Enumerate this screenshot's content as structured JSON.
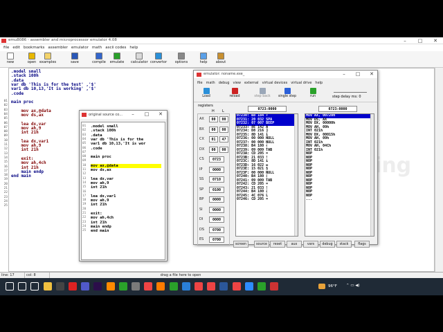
{
  "app": {
    "title": "emu8086 - assembler and microprocessor emulator 4.08",
    "menu": [
      "file",
      "edit",
      "bookmarks",
      "assembler",
      "emulator",
      "math",
      "ascii codes",
      "help"
    ],
    "toolbar": [
      {
        "label": "new",
        "icon": "new-file-icon",
        "color": "#ffffff"
      },
      {
        "label": "open",
        "icon": "open-folder-icon",
        "color": "#e8b800"
      },
      {
        "label": "examples",
        "icon": "examples-icon",
        "color": "#f3d36a"
      },
      {
        "label": "save",
        "icon": "save-icon",
        "color": "#2a58b8"
      },
      {
        "label": "compile",
        "icon": "compile-icon",
        "color": "#3366cc"
      },
      {
        "label": "emulate",
        "icon": "emulate-icon",
        "color": "#2aa12a"
      },
      {
        "label": "calculator",
        "icon": "calculator-icon",
        "color": "#d9d9d9"
      },
      {
        "label": "convertor",
        "icon": "convertor-icon",
        "color": "#2a8fd8"
      },
      {
        "label": "options",
        "icon": "options-icon",
        "color": "#888888"
      },
      {
        "label": "help",
        "icon": "help-icon",
        "color": "#5aa0e8"
      },
      {
        "label": "about",
        "icon": "about-icon",
        "color": "#c89030"
      }
    ],
    "code": [
      {
        "n": "01",
        "text": ".model small",
        "color": "#000080"
      },
      {
        "n": "02",
        "text": ".stack 100h",
        "color": "#000080"
      },
      {
        "n": "03",
        "text": ".data",
        "color": "#000080"
      },
      {
        "n": "04",
        "text": "var db 'This is for the test' ,'$'",
        "color": "#000080"
      },
      {
        "n": "05",
        "text": "var1 db 10,13,'It is working' ,'$'",
        "color": "#000080"
      },
      {
        "n": "06",
        "text": ".code",
        "color": "#000080"
      },
      {
        "n": "07",
        "text": "",
        "color": "#000080"
      },
      {
        "n": "08",
        "text": "main proc",
        "color": "#000080"
      },
      {
        "n": "09",
        "text": "",
        "color": "#000080"
      },
      {
        "n": "10",
        "text": "    mov ax,@data",
        "color": "#800000"
      },
      {
        "n": "11",
        "text": "    mov ds,ax",
        "color": "#800000"
      },
      {
        "n": "12",
        "text": "",
        "color": "#000080"
      },
      {
        "n": "13",
        "text": "    lea dx,var",
        "color": "#800000"
      },
      {
        "n": "14",
        "text": "    mov ah,9",
        "color": "#800000"
      },
      {
        "n": "15",
        "text": "    int 21h",
        "color": "#800000"
      },
      {
        "n": "16",
        "text": "",
        "color": "#000080"
      },
      {
        "n": "17",
        "text": "    lea dx,var1",
        "color": "#800000"
      },
      {
        "n": "18",
        "text": "    mov ah,9",
        "color": "#800000"
      },
      {
        "n": "19",
        "text": "    int 21h",
        "color": "#800000"
      },
      {
        "n": "20",
        "text": "",
        "color": "#000080"
      },
      {
        "n": "21",
        "text": "    exit:",
        "color": "#800000"
      },
      {
        "n": "22",
        "text": "    mov ah,4ch",
        "color": "#800000"
      },
      {
        "n": "23",
        "text": "    int 21h",
        "color": "#800000"
      },
      {
        "n": "24",
        "text": "    main endp",
        "color": "#000080"
      },
      {
        "n": "25",
        "text": "end main",
        "color": "#000080"
      }
    ],
    "status": {
      "line": "line: 17",
      "col": "col: 8",
      "hint": "drag a file here to open"
    }
  },
  "emulator": {
    "title": "emulator: noname.exe_",
    "menu": [
      "file",
      "math",
      "debug",
      "view",
      "external",
      "virtual devices",
      "virtual drive",
      "help"
    ],
    "toolbar": [
      {
        "label": "Load",
        "icon": "load-icon",
        "color": "#2a8fd8"
      },
      {
        "label": "reload",
        "icon": "reload-icon",
        "color": "#cc2222"
      },
      {
        "label": "step back",
        "icon": "step-back-icon",
        "color": "#9aa7b8"
      },
      {
        "label": "single step",
        "icon": "single-step-icon",
        "color": "#2a5fd8"
      },
      {
        "label": "run",
        "icon": "run-icon",
        "color": "#2aa12a"
      }
    ],
    "step_delay": "step delay ms: 0",
    "registers_label": "registers",
    "hl": [
      "H",
      "L"
    ],
    "registers": [
      {
        "name": "AX",
        "h": "00",
        "l": "00"
      },
      {
        "name": "BX",
        "h": "00",
        "l": "00"
      },
      {
        "name": "CX",
        "h": "01",
        "l": "47"
      },
      {
        "name": "DX",
        "h": "00",
        "l": "00"
      },
      {
        "name": "CS",
        "v": "0723"
      },
      {
        "name": "IP",
        "v": "0000"
      },
      {
        "name": "SS",
        "v": "0710"
      },
      {
        "name": "SP",
        "v": "0100"
      },
      {
        "name": "BP",
        "v": "0000"
      },
      {
        "name": "SI",
        "v": "0000"
      },
      {
        "name": "DI",
        "v": "0000"
      },
      {
        "name": "DS",
        "v": "0700"
      },
      {
        "name": "ES",
        "v": "0700"
      }
    ],
    "mem_addr": "0723:0000",
    "dis_addr": "0723:0000",
    "memory": [
      "07230: B8 184 ↑",
      "07231: 20 032 SPA",
      "07232: 07 007 BEEP",
      "07233: 8E 142 Ä",
      "07234: D8 216 ╠",
      "07235: 8D 141 ì",
      "07236: 00 000 NULL",
      "07237: 00 000 NULL",
      "07238: B4 180 ┤",
      "07239: 09 009 TAB",
      "0723A: CD 205 =",
      "0723B: 21 033 !",
      "0723C: 8D 141 ì",
      "0723D: 16 022 ▬",
      "0723E: 15 021 §",
      "0723F: 00 000 NULL",
      "07240: B4 180 ┤",
      "07241: 09 009 TAB",
      "07242: CD 205 =",
      "07243: 21 033 !",
      "07244: B4 180 ┤",
      "07245: 4C 076 L",
      "07246: CD 205 ="
    ],
    "disasm": [
      "MOV AX, 00720h",
      "MOV DS, AX",
      "MOV DX, 00000h",
      "MOV AH, 09h",
      "INT 021h",
      "MOV DX, 00015h",
      "MOV AH, 09h",
      "INT 021h",
      "MOV AH, 04Ch",
      "INT 021h",
      "NOP",
      "NOP",
      "NOP",
      "NOP",
      "NOP",
      "NOP",
      "NOP",
      "NOP",
      "NOP",
      "NOP",
      "NOP",
      "NOP",
      "..."
    ],
    "buttons": [
      "screen",
      "source",
      "reset",
      "aux",
      "vars",
      "debug",
      "stack",
      "flags"
    ]
  },
  "source": {
    "title": "original source co...",
    "lines": [
      {
        "n": "01",
        "text": ".model small"
      },
      {
        "n": "02",
        "text": ".stack 100h"
      },
      {
        "n": "03",
        "text": ".data"
      },
      {
        "n": "04",
        "text": "var db 'This is for the"
      },
      {
        "n": "05",
        "text": "var1 db 10,13,'It is wor"
      },
      {
        "n": "06",
        "text": ".code"
      },
      {
        "n": "07",
        "text": ""
      },
      {
        "n": "08",
        "text": "main proc"
      },
      {
        "n": "09",
        "text": ""
      },
      {
        "n": "10",
        "text": "mov ax,@data"
      },
      {
        "n": "11",
        "text": "mov ds,ax"
      },
      {
        "n": "12",
        "text": ""
      },
      {
        "n": "13",
        "text": "lea dx,var"
      },
      {
        "n": "14",
        "text": "mov ah,9"
      },
      {
        "n": "15",
        "text": "int 21h"
      },
      {
        "n": "16",
        "text": ""
      },
      {
        "n": "17",
        "text": "lea dx,var1"
      },
      {
        "n": "18",
        "text": "mov ah,9"
      },
      {
        "n": "19",
        "text": "int 21h"
      },
      {
        "n": "20",
        "text": ""
      },
      {
        "n": "21",
        "text": "exit:"
      },
      {
        "n": "22",
        "text": "mov ah,4ch"
      },
      {
        "n": "23",
        "text": "int 21h"
      },
      {
        "n": "24",
        "text": "main endp"
      },
      {
        "n": "25",
        "text": "end main"
      }
    ],
    "highlight_line": 10
  },
  "taskbar": {
    "icons": [
      "windows-icon",
      "search-icon",
      "task-view-icon",
      "file-explorer-icon",
      "store-icon",
      "acrobat-icon",
      "teams-icon",
      "after-effects-icon",
      "illustrator-icon",
      "camtasia-icon",
      "snip-icon",
      "chrome-icon",
      "firefox-icon",
      "emu8086-icon",
      "vscode-icon",
      "chrome-icon-2",
      "chrome-icon-3",
      "word-icon",
      "chrome-icon-4",
      "zoom-icon",
      "emu-icon-2",
      "screen-recorder-icon"
    ],
    "temperature": "96°F"
  },
  "watermark": "CSE Soft Learning"
}
